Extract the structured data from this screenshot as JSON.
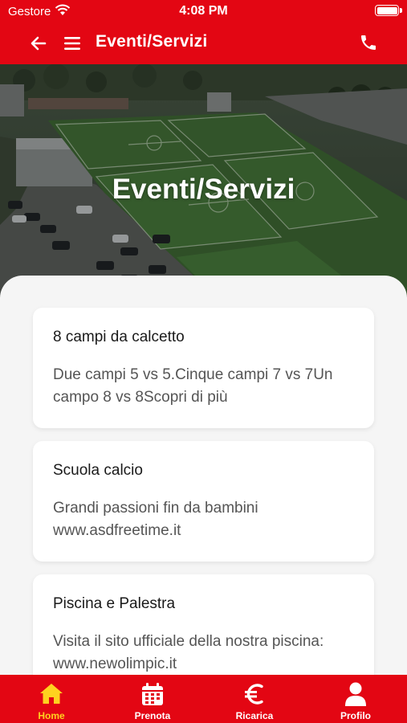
{
  "status_bar": {
    "carrier": "Gestore",
    "time": "4:08 PM"
  },
  "nav": {
    "title": "Eventi/Servizi"
  },
  "hero": {
    "title": "Eventi/Servizi"
  },
  "cards": [
    {
      "title": "8 campi da calcetto",
      "description": "Due campi 5 vs 5.Cinque campi 7 vs 7Un campo 8 vs 8Scopri di più"
    },
    {
      "title": "Scuola calcio",
      "description": "Grandi passioni fin da bambini www.asdfreetime.it"
    },
    {
      "title": "Piscina e Palestra",
      "description": "Visita il sito ufficiale della nostra piscina: www.newolimpic.it"
    }
  ],
  "tab_bar": {
    "items": [
      {
        "label": "Home",
        "icon": "home-icon",
        "active": true
      },
      {
        "label": "Prenota",
        "icon": "calendar-icon",
        "active": false
      },
      {
        "label": "Ricarica",
        "icon": "euro-icon",
        "active": false
      },
      {
        "label": "Profilo",
        "icon": "user-icon",
        "active": false
      }
    ]
  },
  "colors": {
    "brand": "#e30613",
    "active_tab": "#ffd21f"
  }
}
